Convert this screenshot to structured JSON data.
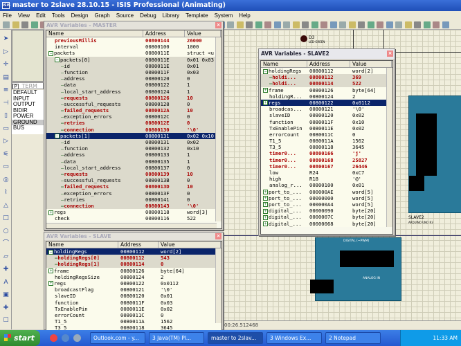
{
  "app": {
    "title": "master to 2slave 28.10.15 - ISIS Professional (Animating)",
    "icon_label": "ISIS"
  },
  "menu": [
    "File",
    "View",
    "Edit",
    "Tools",
    "Design",
    "Graph",
    "Source",
    "Debug",
    "Library",
    "Template",
    "System",
    "Help"
  ],
  "picklist": {
    "mode_button": "P",
    "header": "TERM",
    "items": [
      "DEFAULT",
      "INPUT",
      "OUTPUT",
      "BIDIR",
      "POWER",
      "GROUND",
      "BUS"
    ],
    "selected": "GROUND"
  },
  "columns": {
    "name": "Name",
    "address": "Address",
    "value": "Value"
  },
  "master": {
    "title": "AVR Variables - MASTER",
    "rows": [
      {
        "n": "previousMillis",
        "a": "00800144",
        "v": "26000",
        "lvl": 0,
        "red": true
      },
      {
        "n": "interval",
        "a": "00800100",
        "v": "1000",
        "lvl": 0
      },
      {
        "n": "packets",
        "a": "0080011E",
        "v": "struct <u",
        "lvl": 0,
        "exp": "-"
      },
      {
        "n": "packets[0]",
        "a": "0080011E",
        "v": "0x01 0x03",
        "lvl": 1,
        "exp": "-"
      },
      {
        "n": "id",
        "a": "0080011E",
        "v": "0x01",
        "lvl": 2
      },
      {
        "n": "function",
        "a": "0080011F",
        "v": "0x03",
        "lvl": 2
      },
      {
        "n": "address",
        "a": "00800120",
        "v": "0",
        "lvl": 2
      },
      {
        "n": "data",
        "a": "00800122",
        "v": "1",
        "lvl": 2
      },
      {
        "n": "local_start_address",
        "a": "00800124",
        "v": "1",
        "lvl": 2
      },
      {
        "n": "requests",
        "a": "00800126",
        "v": "10",
        "lvl": 2,
        "red": true
      },
      {
        "n": "successful_requests",
        "a": "00800128",
        "v": "0",
        "lvl": 2
      },
      {
        "n": "failed_requests",
        "a": "0080012A",
        "v": "10",
        "lvl": 2,
        "red": true
      },
      {
        "n": "exception_errors",
        "a": "0080012C",
        "v": "0",
        "lvl": 2
      },
      {
        "n": "retries",
        "a": "0080012E",
        "v": "0",
        "lvl": 2,
        "red": true
      },
      {
        "n": "connection",
        "a": "00800130",
        "v": "'\\0'",
        "lvl": 2,
        "red": true
      },
      {
        "n": "packets[1]",
        "a": "00800131",
        "v": "0x02 0x10",
        "lvl": 1,
        "exp": "-",
        "sel": true
      },
      {
        "n": "id",
        "a": "00800131",
        "v": "0x02",
        "lvl": 2
      },
      {
        "n": "function",
        "a": "00800132",
        "v": "0x10",
        "lvl": 2
      },
      {
        "n": "address",
        "a": "00800133",
        "v": "1",
        "lvl": 2
      },
      {
        "n": "data",
        "a": "00800135",
        "v": "1",
        "lvl": 2
      },
      {
        "n": "local_start_address",
        "a": "00800137",
        "v": "0",
        "lvl": 2
      },
      {
        "n": "requests",
        "a": "00800139",
        "v": "10",
        "lvl": 2,
        "red": true
      },
      {
        "n": "successful_requests",
        "a": "0080013B",
        "v": "0",
        "lvl": 2
      },
      {
        "n": "failed_requests",
        "a": "0080013D",
        "v": "10",
        "lvl": 2,
        "red": true
      },
      {
        "n": "exception_errors",
        "a": "0080013F",
        "v": "0",
        "lvl": 2
      },
      {
        "n": "retries",
        "a": "00800141",
        "v": "0",
        "lvl": 2
      },
      {
        "n": "connection",
        "a": "00800143",
        "v": "'\\0'",
        "lvl": 2,
        "red": true
      },
      {
        "n": "regs",
        "a": "00800118",
        "v": "word[3]",
        "lvl": 0,
        "exp": "+"
      },
      {
        "n": "check",
        "a": "00800116",
        "v": "522",
        "lvl": 0
      }
    ]
  },
  "slave": {
    "title": "AVR Variables - SLAVE",
    "rows": [
      {
        "n": "holdingRegs",
        "a": "00800112",
        "v": "word[2]",
        "lvl": 0,
        "exp": "-",
        "sel": true
      },
      {
        "n": "holdingRegs[0]",
        "a": "00800112",
        "v": "543",
        "lvl": 1,
        "red": true
      },
      {
        "n": "holdingRegs[1]",
        "a": "00800114",
        "v": "0",
        "lvl": 1,
        "red": true
      },
      {
        "n": "frame",
        "a": "00800126",
        "v": "byte[64]",
        "lvl": 0,
        "exp": "+"
      },
      {
        "n": "holdingRegsSize",
        "a": "00800124",
        "v": "2",
        "lvl": 0
      },
      {
        "n": "regs",
        "a": "00800122",
        "v": "0x0112",
        "lvl": 0,
        "exp": "+"
      },
      {
        "n": "broadcastFlag",
        "a": "00800121",
        "v": "'\\0'",
        "lvl": 0
      },
      {
        "n": "slaveID",
        "a": "00800120",
        "v": "0x01",
        "lvl": 0
      },
      {
        "n": "function",
        "a": "0080011F",
        "v": "0x03",
        "lvl": 0
      },
      {
        "n": "TxEnablePin",
        "a": "0080011E",
        "v": "0x02",
        "lvl": 0
      },
      {
        "n": "errorCount",
        "a": "0080011C",
        "v": "0",
        "lvl": 0
      },
      {
        "n": "T1_5",
        "a": "0080011A",
        "v": "1562",
        "lvl": 0
      },
      {
        "n": "T3_5",
        "a": "00800118",
        "v": "3645",
        "lvl": 0
      }
    ]
  },
  "slave2": {
    "title": "AVR Variables - SLAVE2",
    "rows": [
      {
        "n": "holdingRegs",
        "a": "00800112",
        "v": "word[2]",
        "lvl": 0,
        "exp": "-"
      },
      {
        "n": "holdi...",
        "a": "00800112",
        "v": "369",
        "lvl": 1,
        "red": true
      },
      {
        "n": "holdi...",
        "a": "00800114",
        "v": "522",
        "lvl": 1,
        "red": true
      },
      {
        "n": "frame",
        "a": "00800126",
        "v": "byte[64]",
        "lvl": 0,
        "exp": "+"
      },
      {
        "n": "holdingR...",
        "a": "00800124",
        "v": "2",
        "lvl": 0
      },
      {
        "n": "regs",
        "a": "00800122",
        "v": "0x0112",
        "lvl": 0,
        "exp": "+",
        "sel": true
      },
      {
        "n": "broadcas...",
        "a": "00800121",
        "v": "'\\0'",
        "lvl": 0
      },
      {
        "n": "slaveID",
        "a": "00800120",
        "v": "0x02",
        "lvl": 0
      },
      {
        "n": "function",
        "a": "0080011F",
        "v": "0x10",
        "lvl": 0
      },
      {
        "n": "TxEnablePin",
        "a": "0080011E",
        "v": "0x02",
        "lvl": 0
      },
      {
        "n": "errorCount",
        "a": "0080011C",
        "v": "0",
        "lvl": 0
      },
      {
        "n": "T1_5",
        "a": "0080011A",
        "v": "1562",
        "lvl": 0
      },
      {
        "n": "T3_5",
        "a": "00800118",
        "v": "3645",
        "lvl": 0
      },
      {
        "n": "timer0...",
        "a": "00800166",
        "v": "'j'",
        "lvl": 0,
        "red": true
      },
      {
        "n": "timer0...",
        "a": "00800168",
        "v": "25827",
        "lvl": 0,
        "red": true
      },
      {
        "n": "timer0...",
        "a": "00800167",
        "v": "26446",
        "lvl": 0,
        "red": true
      },
      {
        "n": "low",
        "a": "R24",
        "v": "0xC7",
        "lvl": 0
      },
      {
        "n": "high",
        "a": "R18",
        "v": "'@'",
        "lvl": 0
      },
      {
        "n": "analog_r...",
        "a": "00800100",
        "v": "0x01",
        "lvl": 0
      },
      {
        "n": "port_to_...",
        "a": "000000AE",
        "v": "word[5]",
        "lvl": 0,
        "exp": "+"
      },
      {
        "n": "port_to_...",
        "a": "00000000",
        "v": "word[5]",
        "lvl": 0,
        "exp": "+"
      },
      {
        "n": "port_to_...",
        "a": "000000A4",
        "v": "word[5]",
        "lvl": 0,
        "exp": "+"
      },
      {
        "n": "digital_...",
        "a": "00000090",
        "v": "byte[20]",
        "lvl": 0,
        "exp": "+"
      },
      {
        "n": "digital_...",
        "a": "0000007C",
        "v": "byte[20]",
        "lvl": 0,
        "exp": "+"
      },
      {
        "n": "digital_...",
        "a": "00000068",
        "v": "byte[20]",
        "lvl": 0,
        "exp": "+"
      }
    ]
  },
  "schematic": {
    "led_label": "D3",
    "led_sub": "LED-GREEN",
    "board1_label": "SLAVE2",
    "board1_sub": "ARDUINO UNO R3",
    "board_header": "DIGITAL (~PWM)",
    "analog_label": "ANALOG IN"
  },
  "status": {
    "sim_time": "00:26.512468"
  },
  "taskbar": {
    "start": "start",
    "tasks": [
      {
        "label": "Outlook.com - y..."
      },
      {
        "label": "3 Java(TM) Pl..."
      },
      {
        "label": "master to 2slav...",
        "active": true
      },
      {
        "label": "3 Windows Ex..."
      },
      {
        "label": "2 Notepad"
      }
    ],
    "clock": "11:33 AM"
  }
}
